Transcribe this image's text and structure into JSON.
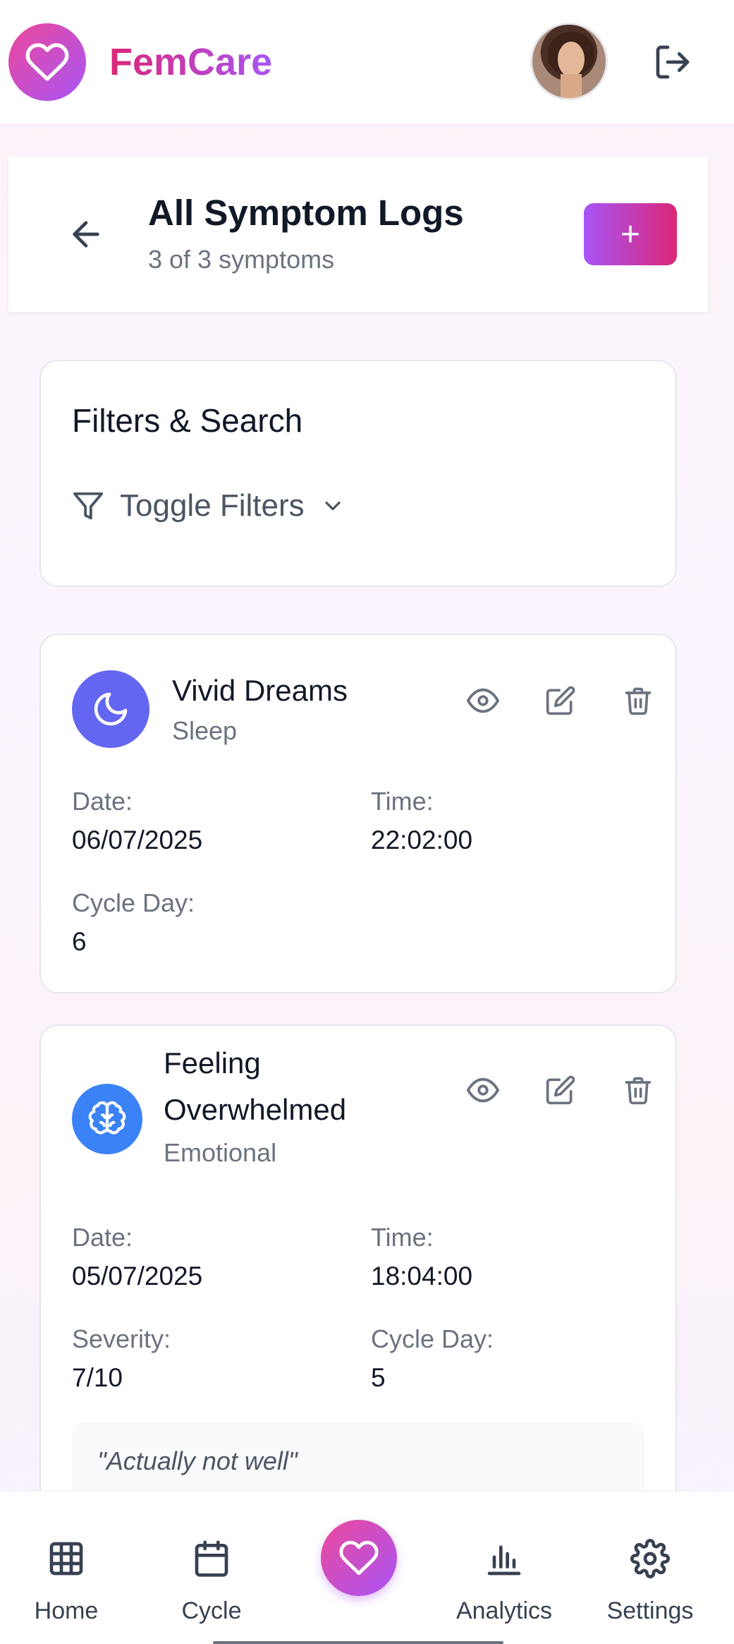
{
  "app": {
    "brand": "FemCare"
  },
  "header": {
    "title": "All Symptom Logs",
    "subtitle": "3 of 3 symptoms",
    "add_label": "+"
  },
  "filters": {
    "title": "Filters & Search",
    "toggle_label": "Toggle Filters"
  },
  "logs": [
    {
      "name": "Vivid Dreams",
      "category": "Sleep",
      "icon": "moon-icon",
      "icon_color": "#6366f1",
      "date_label": "Date:",
      "date": "06/07/2025",
      "time_label": "Time:",
      "time": "22:02:00",
      "cycle_label": "Cycle Day:",
      "cycle_day": "6"
    },
    {
      "name_line1": "Feeling",
      "name_line2": "Overwhelmed",
      "category": "Emotional",
      "icon": "brain-icon",
      "icon_color": "#3b82f6",
      "date_label": "Date:",
      "date": "05/07/2025",
      "time_label": "Time:",
      "time": "18:04:00",
      "severity_label": "Severity:",
      "severity": "7/10",
      "cycle_label": "Cycle Day:",
      "cycle_day": "5",
      "note": "\"Actually not well\""
    }
  ],
  "nav": {
    "items": [
      {
        "label": "Home",
        "icon": "grid-icon"
      },
      {
        "label": "Cycle",
        "icon": "calendar-icon"
      },
      {
        "label": "",
        "icon": "heart-icon"
      },
      {
        "label": "Analytics",
        "icon": "bar-chart-icon"
      },
      {
        "label": "Settings",
        "icon": "gear-icon"
      }
    ]
  },
  "colors": {
    "brand_gradient_start": "#ec4899",
    "brand_gradient_end": "#a855f7"
  }
}
